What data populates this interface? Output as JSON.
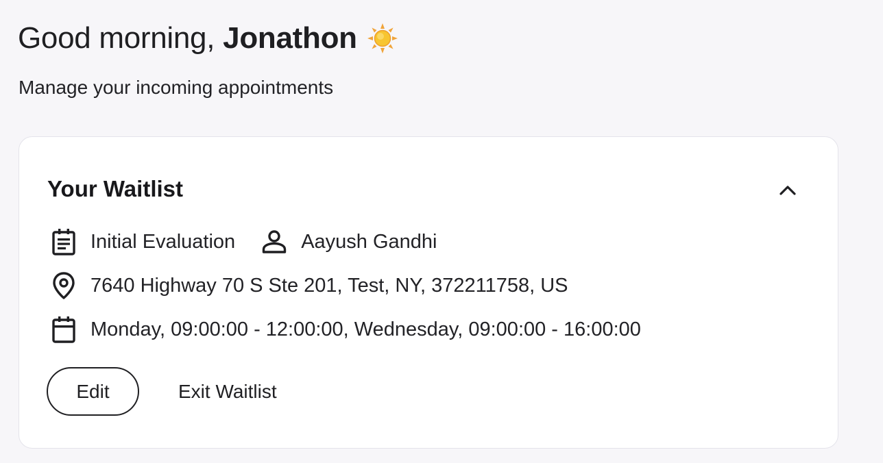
{
  "header": {
    "greeting_prefix": "Good morning,",
    "user_name": "Jonathon",
    "greeting_icon": "sun-icon",
    "subtitle": "Manage your incoming appointments"
  },
  "waitlist": {
    "title": "Your Waitlist",
    "collapse_icon": "chevron-up-icon",
    "service_icon": "clipboard-icon",
    "service": "Initial Evaluation",
    "provider_icon": "person-icon",
    "provider": "Aayush Gandhi",
    "location_icon": "map-pin-icon",
    "address": "7640 Highway 70 S Ste 201, Test, NY, 372211758, US",
    "schedule_icon": "calendar-icon",
    "schedule": "Monday, 09:00:00 - 12:00:00, Wednesday, 09:00:00 - 16:00:00",
    "edit_label": "Edit",
    "exit_label": "Exit Waitlist"
  },
  "colors": {
    "background": "#f7f6f9",
    "card": "#ffffff",
    "text": "#1f1f22",
    "sun": "#f4b624"
  }
}
